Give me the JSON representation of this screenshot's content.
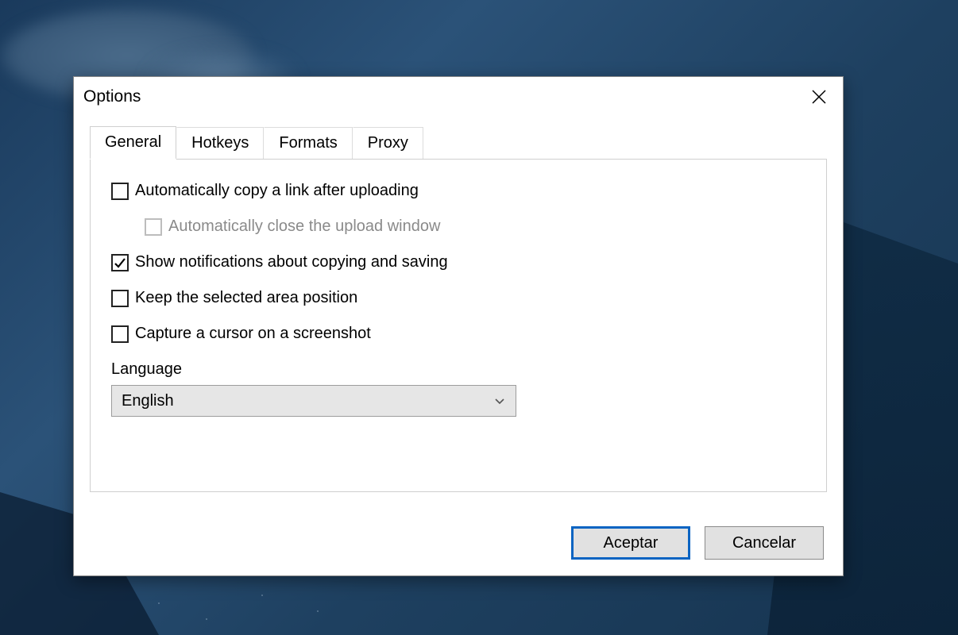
{
  "window": {
    "title": "Options"
  },
  "tabs": [
    {
      "label": "General",
      "active": true
    },
    {
      "label": "Hotkeys",
      "active": false
    },
    {
      "label": "Formats",
      "active": false
    },
    {
      "label": "Proxy",
      "active": false
    }
  ],
  "general": {
    "auto_copy_link": {
      "label": "Automatically copy a link after uploading",
      "checked": false
    },
    "auto_close_upload": {
      "label": "Automatically close the upload window",
      "checked": false,
      "disabled": true
    },
    "show_notifications": {
      "label": "Show notifications about copying and saving",
      "checked": true
    },
    "keep_area_position": {
      "label": "Keep the selected area position",
      "checked": false
    },
    "capture_cursor": {
      "label": "Capture a cursor on a screenshot",
      "checked": false
    },
    "language_label": "Language",
    "language_value": "English"
  },
  "buttons": {
    "accept": "Aceptar",
    "cancel": "Cancelar"
  }
}
